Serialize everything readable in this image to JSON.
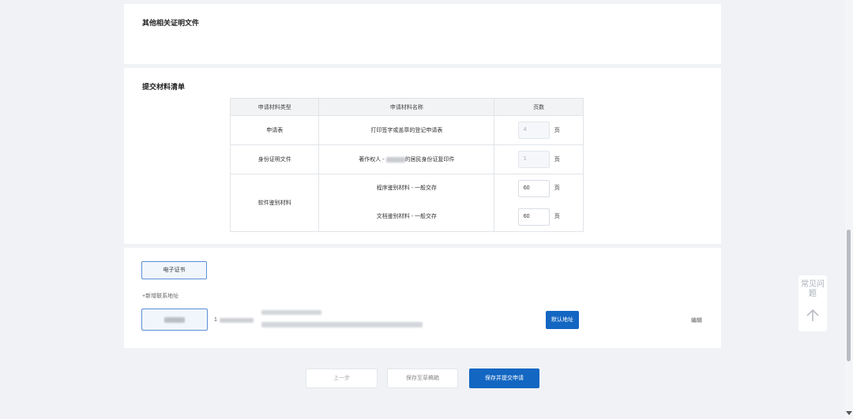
{
  "sections": {
    "other_docs_title": "其他相关证明文件",
    "material_list_title": "提交材料清单"
  },
  "materials_table": {
    "headers": [
      "申请材料类型",
      "申请材料名称",
      "页数"
    ],
    "page_unit": "页",
    "rows": [
      {
        "type": "申请表",
        "name": "打印签字或盖章的登记申请表",
        "pages": "4",
        "editable": false
      },
      {
        "type": "身份证明文件",
        "name_prefix": "著作权人 - ",
        "name_suffix": "的居民身份证复印件",
        "pages": "1",
        "editable": false
      },
      {
        "type": "软件鉴别材料",
        "name": "程序鉴别材料 - 一般交存",
        "pages": "60",
        "editable": true
      },
      {
        "name": "文档鉴别材料 - 一般交存",
        "pages": "60",
        "editable": true
      }
    ]
  },
  "certificate": {
    "button_label": "电子证书"
  },
  "address": {
    "add_link": "+新增联系地址",
    "phone_prefix": "1",
    "default_button": "默认地址",
    "edit_link": "编辑"
  },
  "footer_buttons": {
    "prev": "上一步",
    "save_draft": "保存至草稿箱",
    "save_submit": "保存并提交申请"
  },
  "faq": {
    "label": "常见问题",
    "icon": "arrow-up-icon"
  },
  "colors": {
    "primary": "#1366c2",
    "page_bg": "#f0f2f5",
    "table_header_bg": "#f2f3f5"
  }
}
